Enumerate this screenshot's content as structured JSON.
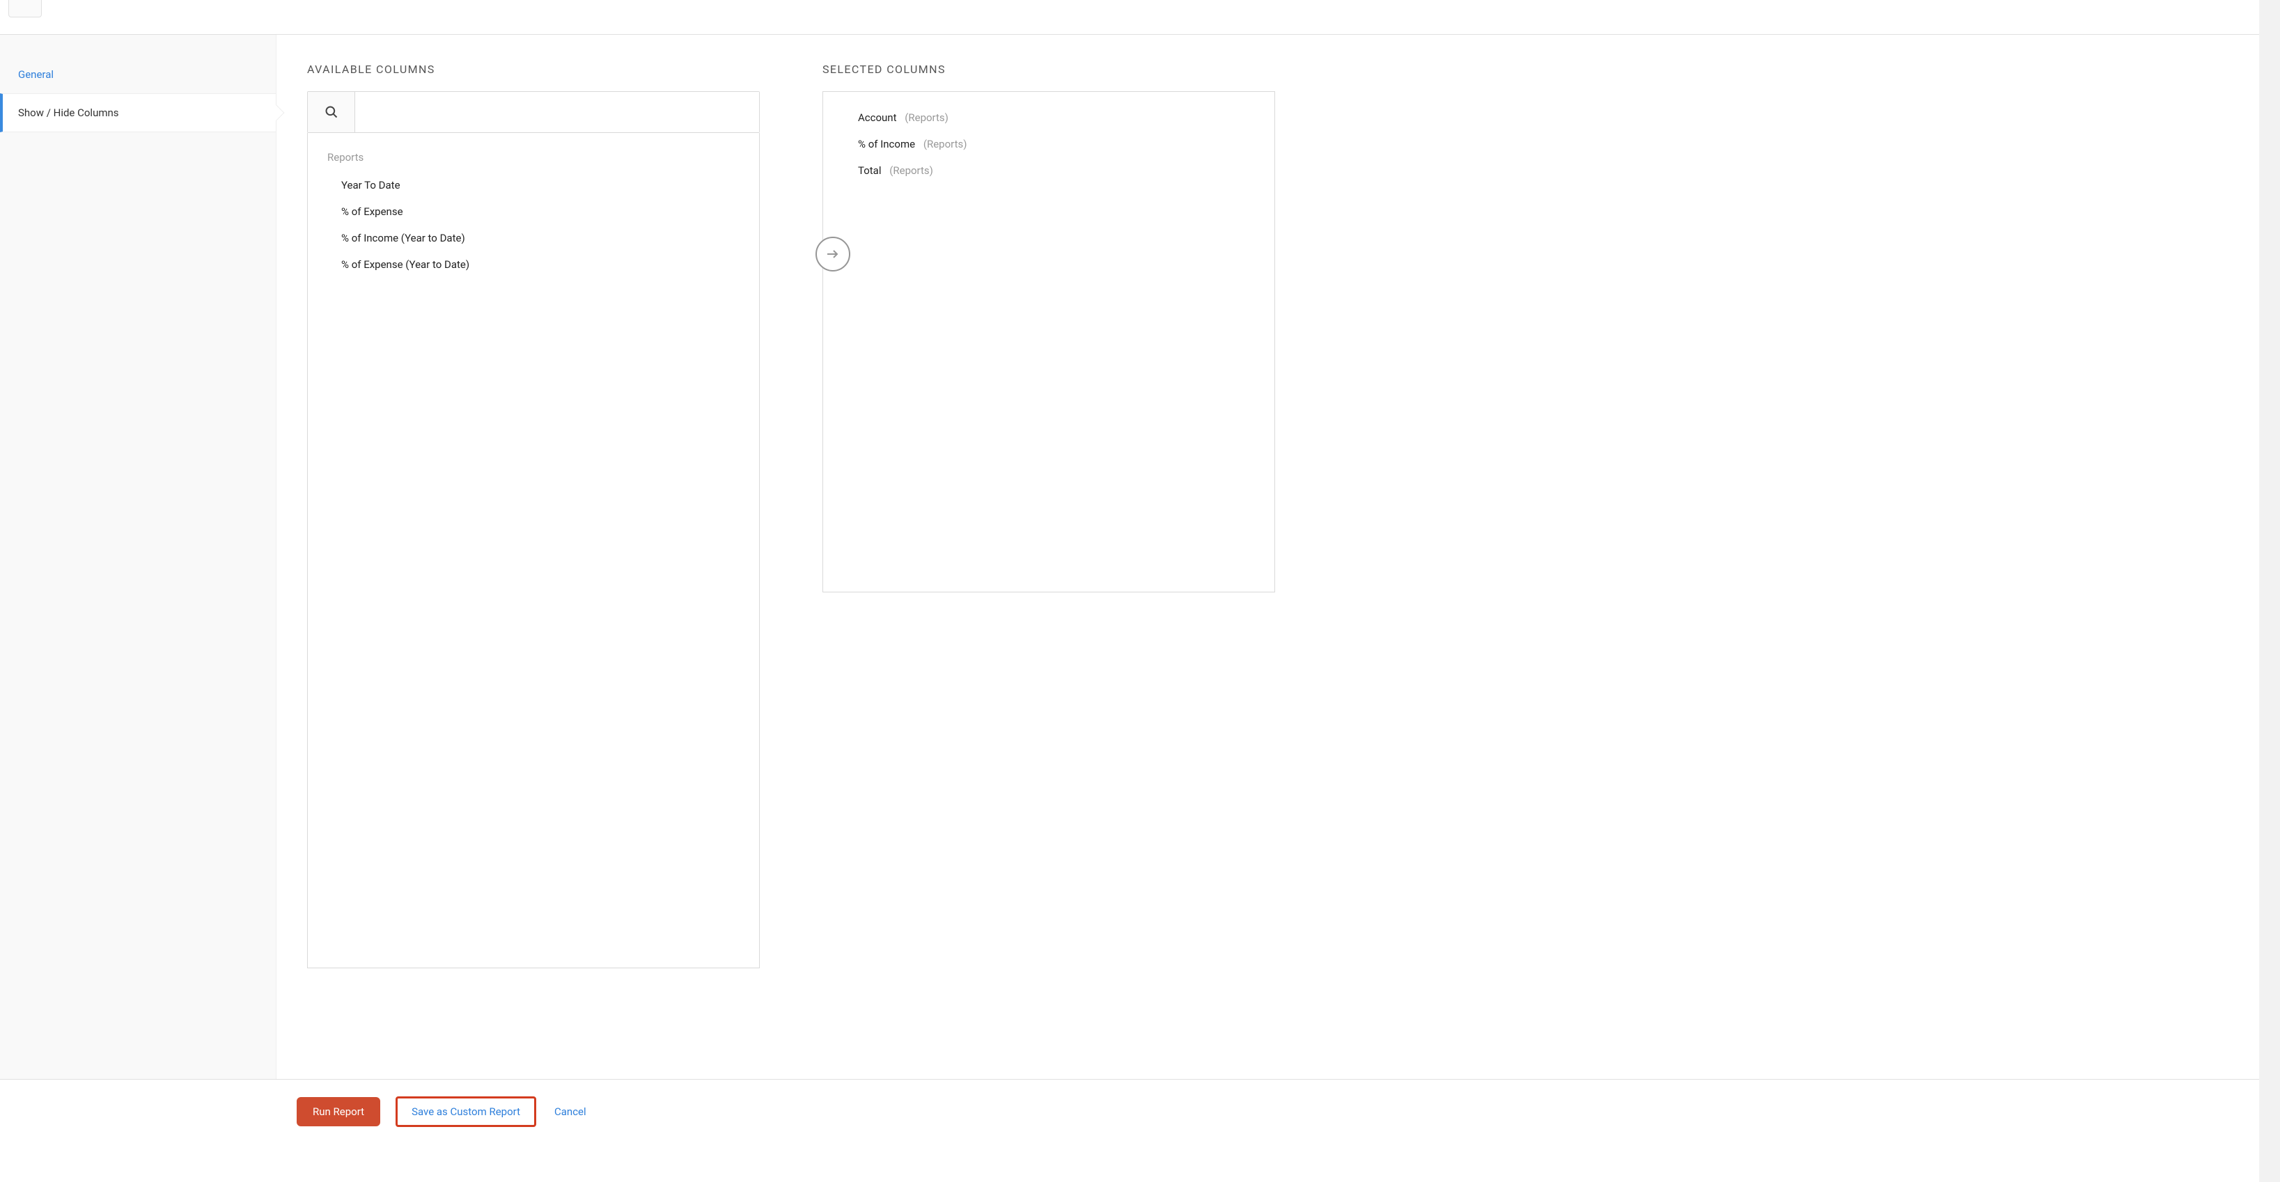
{
  "sidebar": {
    "items": [
      {
        "label": "General",
        "active": false,
        "linkStyle": true
      },
      {
        "label": "Show / Hide Columns",
        "active": true,
        "linkStyle": false
      }
    ]
  },
  "panels": {
    "available": {
      "title": "AVAILABLE COLUMNS",
      "search_placeholder": "",
      "group_label": "Reports",
      "items": [
        "Year To Date",
        "% of Expense",
        "% of Income (Year to Date)",
        "% of Expense (Year to Date)"
      ]
    },
    "selected": {
      "title": "SELECTED COLUMNS",
      "items": [
        {
          "label": "Account",
          "source": "(Reports)"
        },
        {
          "label": "% of Income",
          "source": "(Reports)"
        },
        {
          "label": "Total",
          "source": "(Reports)"
        }
      ]
    }
  },
  "buttons": {
    "run": "Run Report",
    "save_custom": "Save as Custom Report",
    "cancel": "Cancel"
  }
}
